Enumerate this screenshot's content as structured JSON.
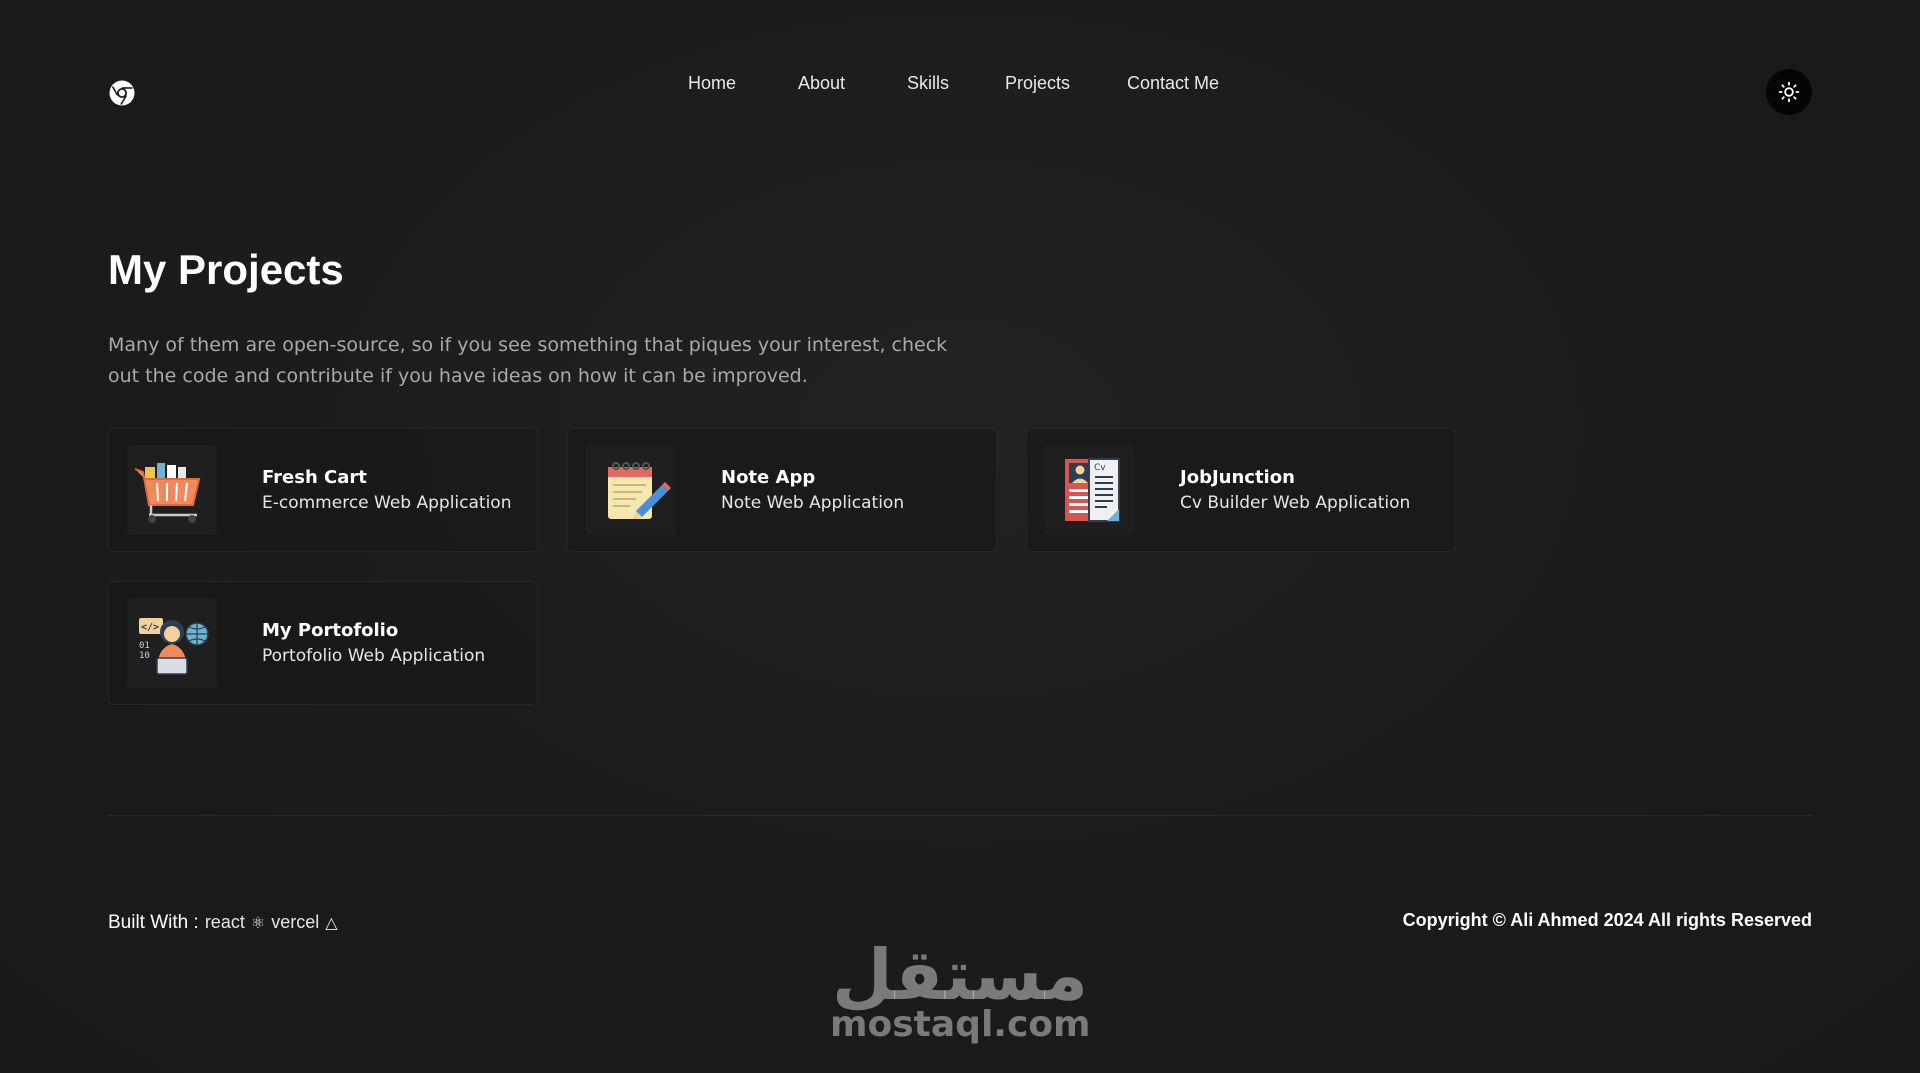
{
  "header": {
    "logo_icon": "chrome-style-logo-icon",
    "nav": [
      {
        "label": "Home"
      },
      {
        "label": "About"
      },
      {
        "label": "Skills"
      },
      {
        "label": "Projects"
      },
      {
        "label": "Contact Me"
      }
    ],
    "theme_toggle_icon": "sun-icon"
  },
  "main": {
    "title": "My Projects",
    "intro": "Many of them are open-source, so if you see something that piques your interest, check out the code and contribute if you have ideas on how it can be improved.",
    "projects": [
      {
        "name": "Fresh Cart",
        "description": "E-commerce Web Application",
        "icon": "shopping-cart-icon"
      },
      {
        "name": "Note App",
        "description": "Note Web Application",
        "icon": "notepad-pencil-icon"
      },
      {
        "name": "JobJunction",
        "description": "Cv Builder Web Application",
        "icon": "cv-document-icon"
      },
      {
        "name": "My Portofolio",
        "description": "Portofolio Web Application",
        "icon": "developer-laptop-icon"
      }
    ]
  },
  "footer": {
    "built_with_label": "Built With :",
    "tech_1": "react",
    "tech_1_glyph": "⚛",
    "tech_2": "vercel",
    "tech_2_glyph": "△",
    "copyright": "Copyright © Ali Ahmed 2024 All rights Reserved"
  },
  "watermark": {
    "arabic": "مستقل",
    "latin": "mostaql.com"
  },
  "colors": {
    "background": "#1c1c1c",
    "text": "#ffffff",
    "muted_text": "#a9a9a9",
    "theme_button": "#050505"
  }
}
